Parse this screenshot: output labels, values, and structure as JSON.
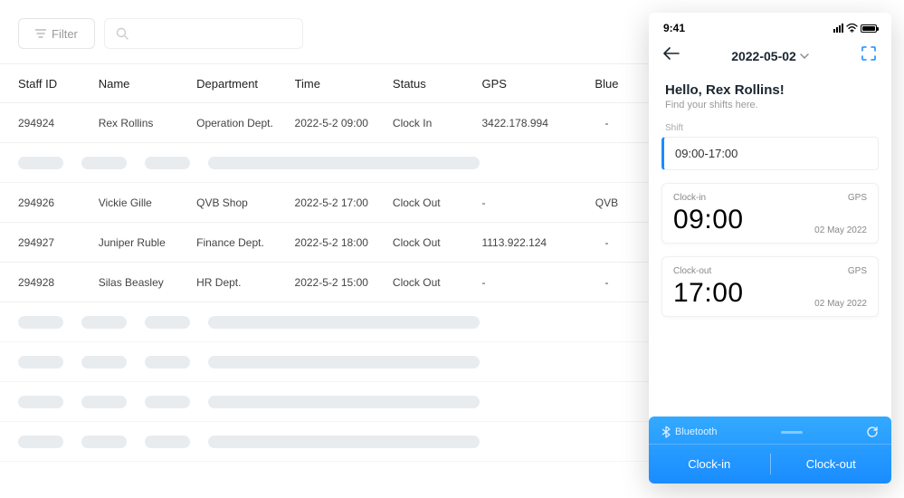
{
  "toolbar": {
    "filter_label": "Filter"
  },
  "table": {
    "headers": {
      "staff_id": "Staff ID",
      "name": "Name",
      "department": "Department",
      "time": "Time",
      "status": "Status",
      "gps": "GPS",
      "bluetooth": "Blue"
    },
    "rows": [
      {
        "id": "294924",
        "name": "Rex Rollins",
        "dept": "Operation Dept.",
        "time": "2022-5-2 09:00",
        "status": "Clock In",
        "gps": "3422.178.994",
        "blue": "-"
      },
      {
        "id": "294926",
        "name": "Vickie Gille",
        "dept": "QVB Shop",
        "time": "2022-5-2 17:00",
        "status": "Clock Out",
        "gps": "-",
        "blue": "QVB"
      },
      {
        "id": "294927",
        "name": "Juniper Ruble",
        "dept": "Finance Dept.",
        "time": "2022-5-2 18:00",
        "status": "Clock Out",
        "gps": "1113.922.124",
        "blue": "-"
      },
      {
        "id": "294928",
        "name": "Silas Beasley",
        "dept": "HR Dept.",
        "time": "2022-5-2 15:00",
        "status": "Clock Out",
        "gps": "-",
        "blue": "-"
      }
    ]
  },
  "phone": {
    "time": "9:41",
    "date": "2022-05-02",
    "greeting": "Hello, Rex Rollins!",
    "subtitle": "Find your shifts here.",
    "shift_label": "Shift",
    "shift_time": "09:00-17:00",
    "clock_in": {
      "label": "Clock-in",
      "method": "GPS",
      "time": "09:00",
      "date": "02 May 2022"
    },
    "clock_out": {
      "label": "Clock-out",
      "method": "GPS",
      "time": "17:00",
      "date": "02 May 2022"
    },
    "bluetooth": {
      "label": "Bluetooth",
      "clock_in": "Clock-in",
      "clock_out": "Clock-out"
    }
  }
}
